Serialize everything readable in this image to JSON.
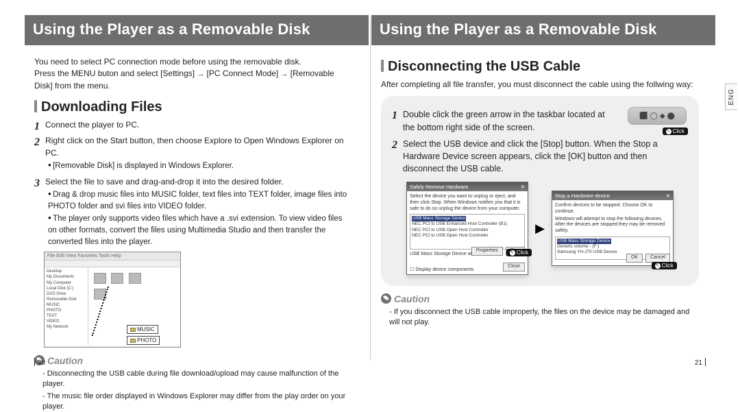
{
  "left": {
    "header": "Using the Player as a Removable Disk",
    "intro_line1": "You need to select PC connection mode before using the removable disk.",
    "intro_line2_a": "Press the MENU buton and select [Settings]",
    "intro_line2_b": "[PC Connect Mode]",
    "intro_line2_c": "[Removable Disk] from the menu.",
    "section": "Downloading Files",
    "steps": {
      "s1": "Connect the player to PC.",
      "s2": "Right click on the Start button, then choose Explore to Open Windows Explorer on PC.",
      "s2_sub1": "[Removable Disk] is displayed in Windows Explorer.",
      "s3": "Select the file to save and drag-and-drop it into the desired folder.",
      "s3_sub1": "Drag & drop music files into MUSIC folder, text files into TEXT folder, image files into PHOTO folder and svi files into VIDEO folder.",
      "s3_sub2": "The player only supports video files which have a .svi extension. To view video files on other formats, convert the files using Multimedia Studio and then transfer the converted files into the player."
    },
    "figure": {
      "menubar": "File  Edit  View  Favorites  Tools  Help",
      "tree": "Desktop\n My Documents\n My Computer\n  Local Disk (C:)\n  DVD Drive\n  Removable Disk\n   MUSIC\n   PHOTO\n   TEXT\n   VIDEO\n My Network",
      "tag_music": "MUSIC",
      "tag_photo": "PHOTO"
    },
    "caution_label": "Caution",
    "caution_items": {
      "c1": "Disconnecting the USB cable during file download/upload may cause malfunction of the player.",
      "c2": "The music file order displayed in Windows Explorer may differ from the play order on your player."
    },
    "page_num": "20"
  },
  "right": {
    "header": "Using the Player as a Removable Disk",
    "lang_tab": "ENG",
    "section": "Disconnecting the USB Cable",
    "intro": "After completing all file transfer, you must disconnect the cable using the follwing way:",
    "steps": {
      "s1": "Double click the green arrow in the taskbar located at the bottom right side of the screen.",
      "s2": "Select the USB device and click the [Stop] button. When the Stop a Hardware Device screen appears, click the [OK] button and then disconnect the USB cable."
    },
    "click": "Click",
    "dlg1": {
      "title": "Safely Remove Hardware",
      "hint": "Select the device you want to unplug or eject, and then click Stop. When Windows notifies you that it is safe to do so unplug the device from your computer.",
      "item_hl": "USB Mass Storage Device",
      "item_b": "NEC PCI to USB Enhanced Host Controller (B1)",
      "item_c": "NEC PCI to USB Open Host Controller",
      "item_d": "NEC PCI to USB Open Host Controller",
      "loc": "USB Mass Storage Device at Location 0",
      "chk": "Display device components",
      "btn_prop": "Properties",
      "btn_stop": "Stop",
      "btn_close": "Close"
    },
    "dlg2": {
      "title": "Stop a Hardware device",
      "hint": "Confirm devices to be stopped. Choose OK to continue.",
      "hint2": "Windows will attempt to stop the following devices. After the devices are stopped they may be removed safely.",
      "item_hl": "USB Mass Storage Device",
      "item_b": "Generic volume - (F:)",
      "item_c": "Samsung YH-J70 USB Device",
      "btn_ok": "OK",
      "btn_cancel": "Cancel"
    },
    "caution_label": "Caution",
    "caution_items": {
      "c1": "If you disconnect the USB cable improperly, the files on the device may be damaged and will not play."
    },
    "page_num": "21"
  }
}
